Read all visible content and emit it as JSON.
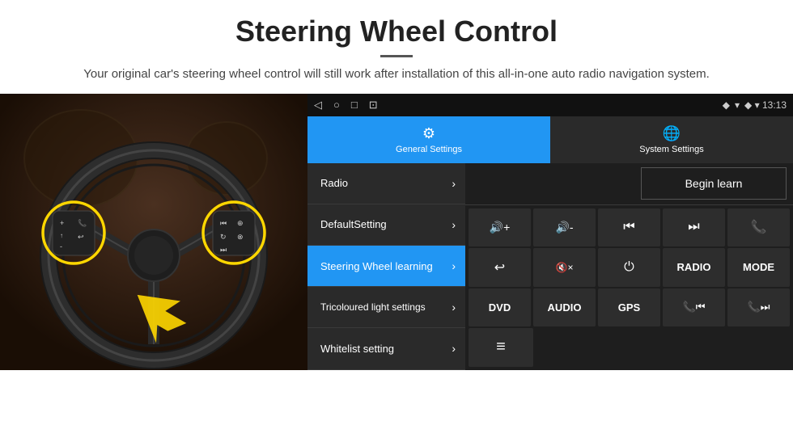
{
  "header": {
    "title": "Steering Wheel Control",
    "divider": true,
    "subtitle": "Your original car's steering wheel control will still work after installation of this all-in-one auto radio navigation system."
  },
  "status_bar": {
    "icons": [
      "◁",
      "○",
      "□",
      "⊡"
    ],
    "right": "◆ ▾  13:13"
  },
  "tabs": [
    {
      "id": "general",
      "label": "General Settings",
      "icon": "⚙",
      "active": true
    },
    {
      "id": "system",
      "label": "System Settings",
      "icon": "🌐",
      "active": false
    }
  ],
  "menu_items": [
    {
      "id": "radio",
      "label": "Radio",
      "active": false
    },
    {
      "id": "default",
      "label": "DefaultSetting",
      "active": false
    },
    {
      "id": "steering",
      "label": "Steering Wheel learning",
      "active": true
    },
    {
      "id": "tricoloured",
      "label": "Tricoloured light settings",
      "active": false
    },
    {
      "id": "whitelist",
      "label": "Whitelist setting",
      "active": false
    }
  ],
  "controls": {
    "begin_learn": "Begin learn",
    "rows": [
      [
        {
          "type": "icon",
          "symbol": "🔊+",
          "label": "volume-up"
        },
        {
          "type": "icon",
          "symbol": "🔊-",
          "label": "volume-down"
        },
        {
          "type": "icon",
          "symbol": "⏮",
          "label": "prev-track"
        },
        {
          "type": "icon",
          "symbol": "⏭",
          "label": "next-track"
        },
        {
          "type": "icon",
          "symbol": "📞",
          "label": "call"
        }
      ],
      [
        {
          "type": "icon",
          "symbol": "↩",
          "label": "hang-up"
        },
        {
          "type": "icon",
          "symbol": "🔇×",
          "label": "mute"
        },
        {
          "type": "icon",
          "symbol": "⏻",
          "label": "power"
        },
        {
          "type": "text",
          "symbol": "RADIO",
          "label": "radio-btn"
        },
        {
          "type": "text",
          "symbol": "MODE",
          "label": "mode-btn"
        }
      ],
      [
        {
          "type": "text",
          "symbol": "DVD",
          "label": "dvd-btn"
        },
        {
          "type": "text",
          "symbol": "AUDIO",
          "label": "audio-btn"
        },
        {
          "type": "text",
          "symbol": "GPS",
          "label": "gps-btn"
        },
        {
          "type": "icon",
          "symbol": "📞⏮",
          "label": "call-prev"
        },
        {
          "type": "icon",
          "symbol": "📞⏭",
          "label": "call-next"
        }
      ],
      [
        {
          "type": "icon",
          "symbol": "≡",
          "label": "menu-icon"
        }
      ]
    ]
  }
}
